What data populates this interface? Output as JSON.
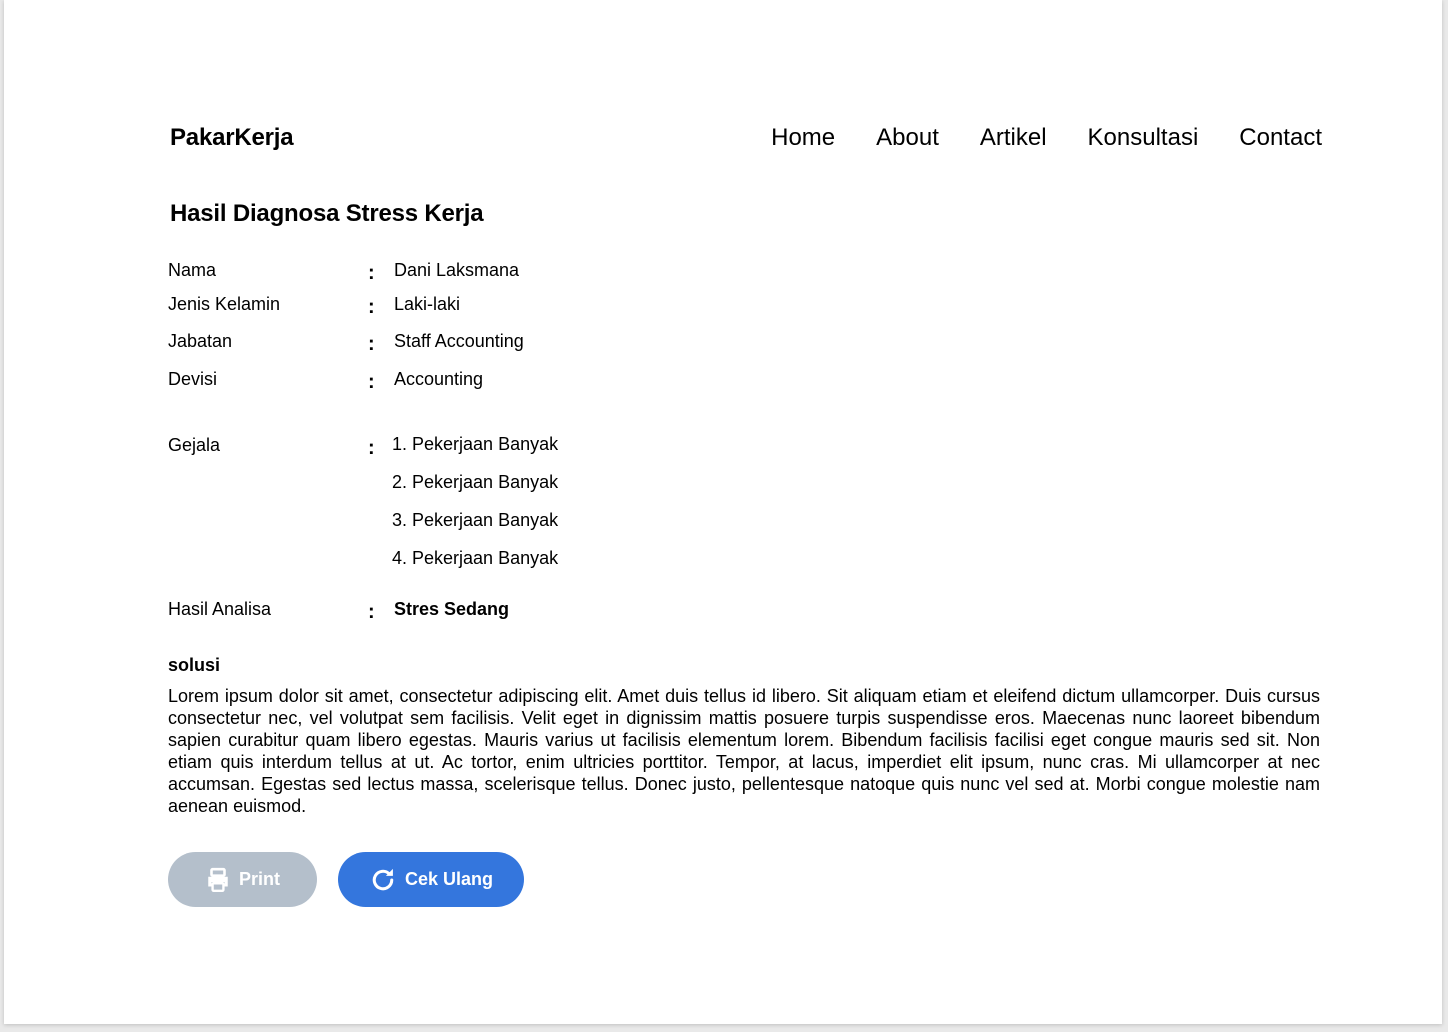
{
  "brand": "PakarKerja",
  "nav": {
    "home": "Home",
    "about": "About",
    "artikel": "Artikel",
    "konsultasi": "Konsultasi",
    "contact": "Contact"
  },
  "page_title": "Hasil Diagnosa Stress Kerja",
  "colon": ":",
  "fields": {
    "nama": {
      "label": "Nama",
      "value": "Dani Laksmana"
    },
    "jenis_kelamin": {
      "label": "Jenis Kelamin",
      "value": "Laki-laki"
    },
    "jabatan": {
      "label": "Jabatan",
      "value": "Staff Accounting"
    },
    "devisi": {
      "label": "Devisi",
      "value": "Accounting"
    }
  },
  "gejala": {
    "label": "Gejala",
    "items": [
      "1. Pekerjaan Banyak",
      "2. Pekerjaan Banyak",
      "3. Pekerjaan Banyak",
      "4. Pekerjaan Banyak"
    ]
  },
  "hasil": {
    "label": "Hasil Analisa",
    "value": "Stres Sedang"
  },
  "solusi": {
    "title": "solusi",
    "text": "Lorem ipsum dolor sit amet, consectetur adipiscing elit. Amet duis tellus id libero. Sit aliquam etiam et eleifend dictum ullamcorper. Duis cursus consectetur nec, vel volutpat sem facilisis. Velit eget in dignissim mattis posuere turpis suspendisse eros. Maecenas nunc laoreet bibendum sapien curabitur quam libero egestas. Mauris varius ut facilisis elementum lorem. Bibendum facilisis facilisi eget congue mauris sed sit. Non etiam quis interdum tellus at ut. Ac tortor, enim ultricies porttitor. Tempor, at lacus, imperdiet elit ipsum, nunc cras. Mi ullamcorper at nec accumsan. Egestas sed lectus massa, scelerisque tellus. Donec justo, pellentesque natoque quis nunc vel sed at. Morbi congue molestie nam aenean euismod."
  },
  "buttons": {
    "print": {
      "label": "Print",
      "icon": "printer-icon",
      "color": "#b4bfcb"
    },
    "cek_ulang": {
      "label": "Cek Ulang",
      "icon": "refresh-icon",
      "color": "#3476dd"
    }
  }
}
